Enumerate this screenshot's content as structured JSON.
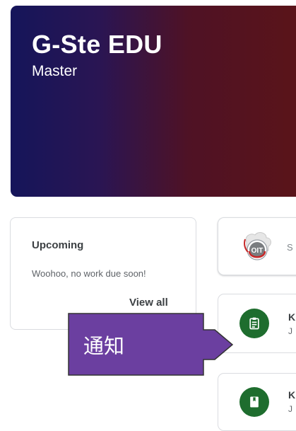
{
  "banner": {
    "title": "G-Ste EDU",
    "subtitle": "Master"
  },
  "upcoming": {
    "title": "Upcoming",
    "empty_message": "Woohoo, no work due soon!",
    "view_all": "View all"
  },
  "stream": {
    "compose_placeholder": "S",
    "posts": [
      {
        "icon": "assignment-icon",
        "title": "K",
        "date": "J"
      },
      {
        "icon": "material-icon",
        "title": "K",
        "date": "J"
      }
    ]
  },
  "annotation": {
    "label": "通知"
  },
  "colors": {
    "banner_start": "#15155a",
    "banner_end": "#5b1418",
    "post_icon_bg": "#1e6d2e",
    "callout_fill": "#6b3fa0"
  },
  "avatar_badge": "OIT"
}
